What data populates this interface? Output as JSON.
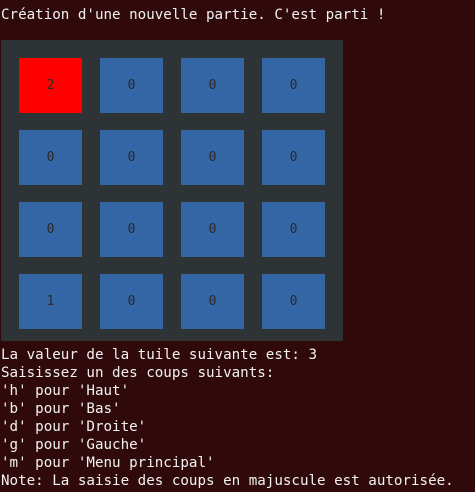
{
  "intro": "Création d'une nouvelle partie. C'est parti !",
  "board": {
    "rows": [
      [
        "2",
        "0",
        "0",
        "0"
      ],
      [
        "0",
        "0",
        "0",
        "0"
      ],
      [
        "0",
        "0",
        "0",
        "0"
      ],
      [
        "1",
        "0",
        "0",
        "0"
      ]
    ],
    "highlighted_tile": "2",
    "colors": {
      "terminal_background": "#300a0a",
      "board_background": "#2e3436",
      "tile": "#3465a4",
      "highlighted_tile": "#ff0000",
      "text": "#f2f2f2"
    }
  },
  "next_tile_text": "La valeur de la tuile suivante est: 3",
  "prompt": "Saisissez un des coups suivants:",
  "options": [
    "'h' pour 'Haut'",
    "'b' pour 'Bas'",
    "'d' pour 'Droite'",
    "'g' pour 'Gauche'",
    "'m' pour 'Menu principal'"
  ],
  "note": "Note: La saisie des coups en majuscule est autorisée."
}
